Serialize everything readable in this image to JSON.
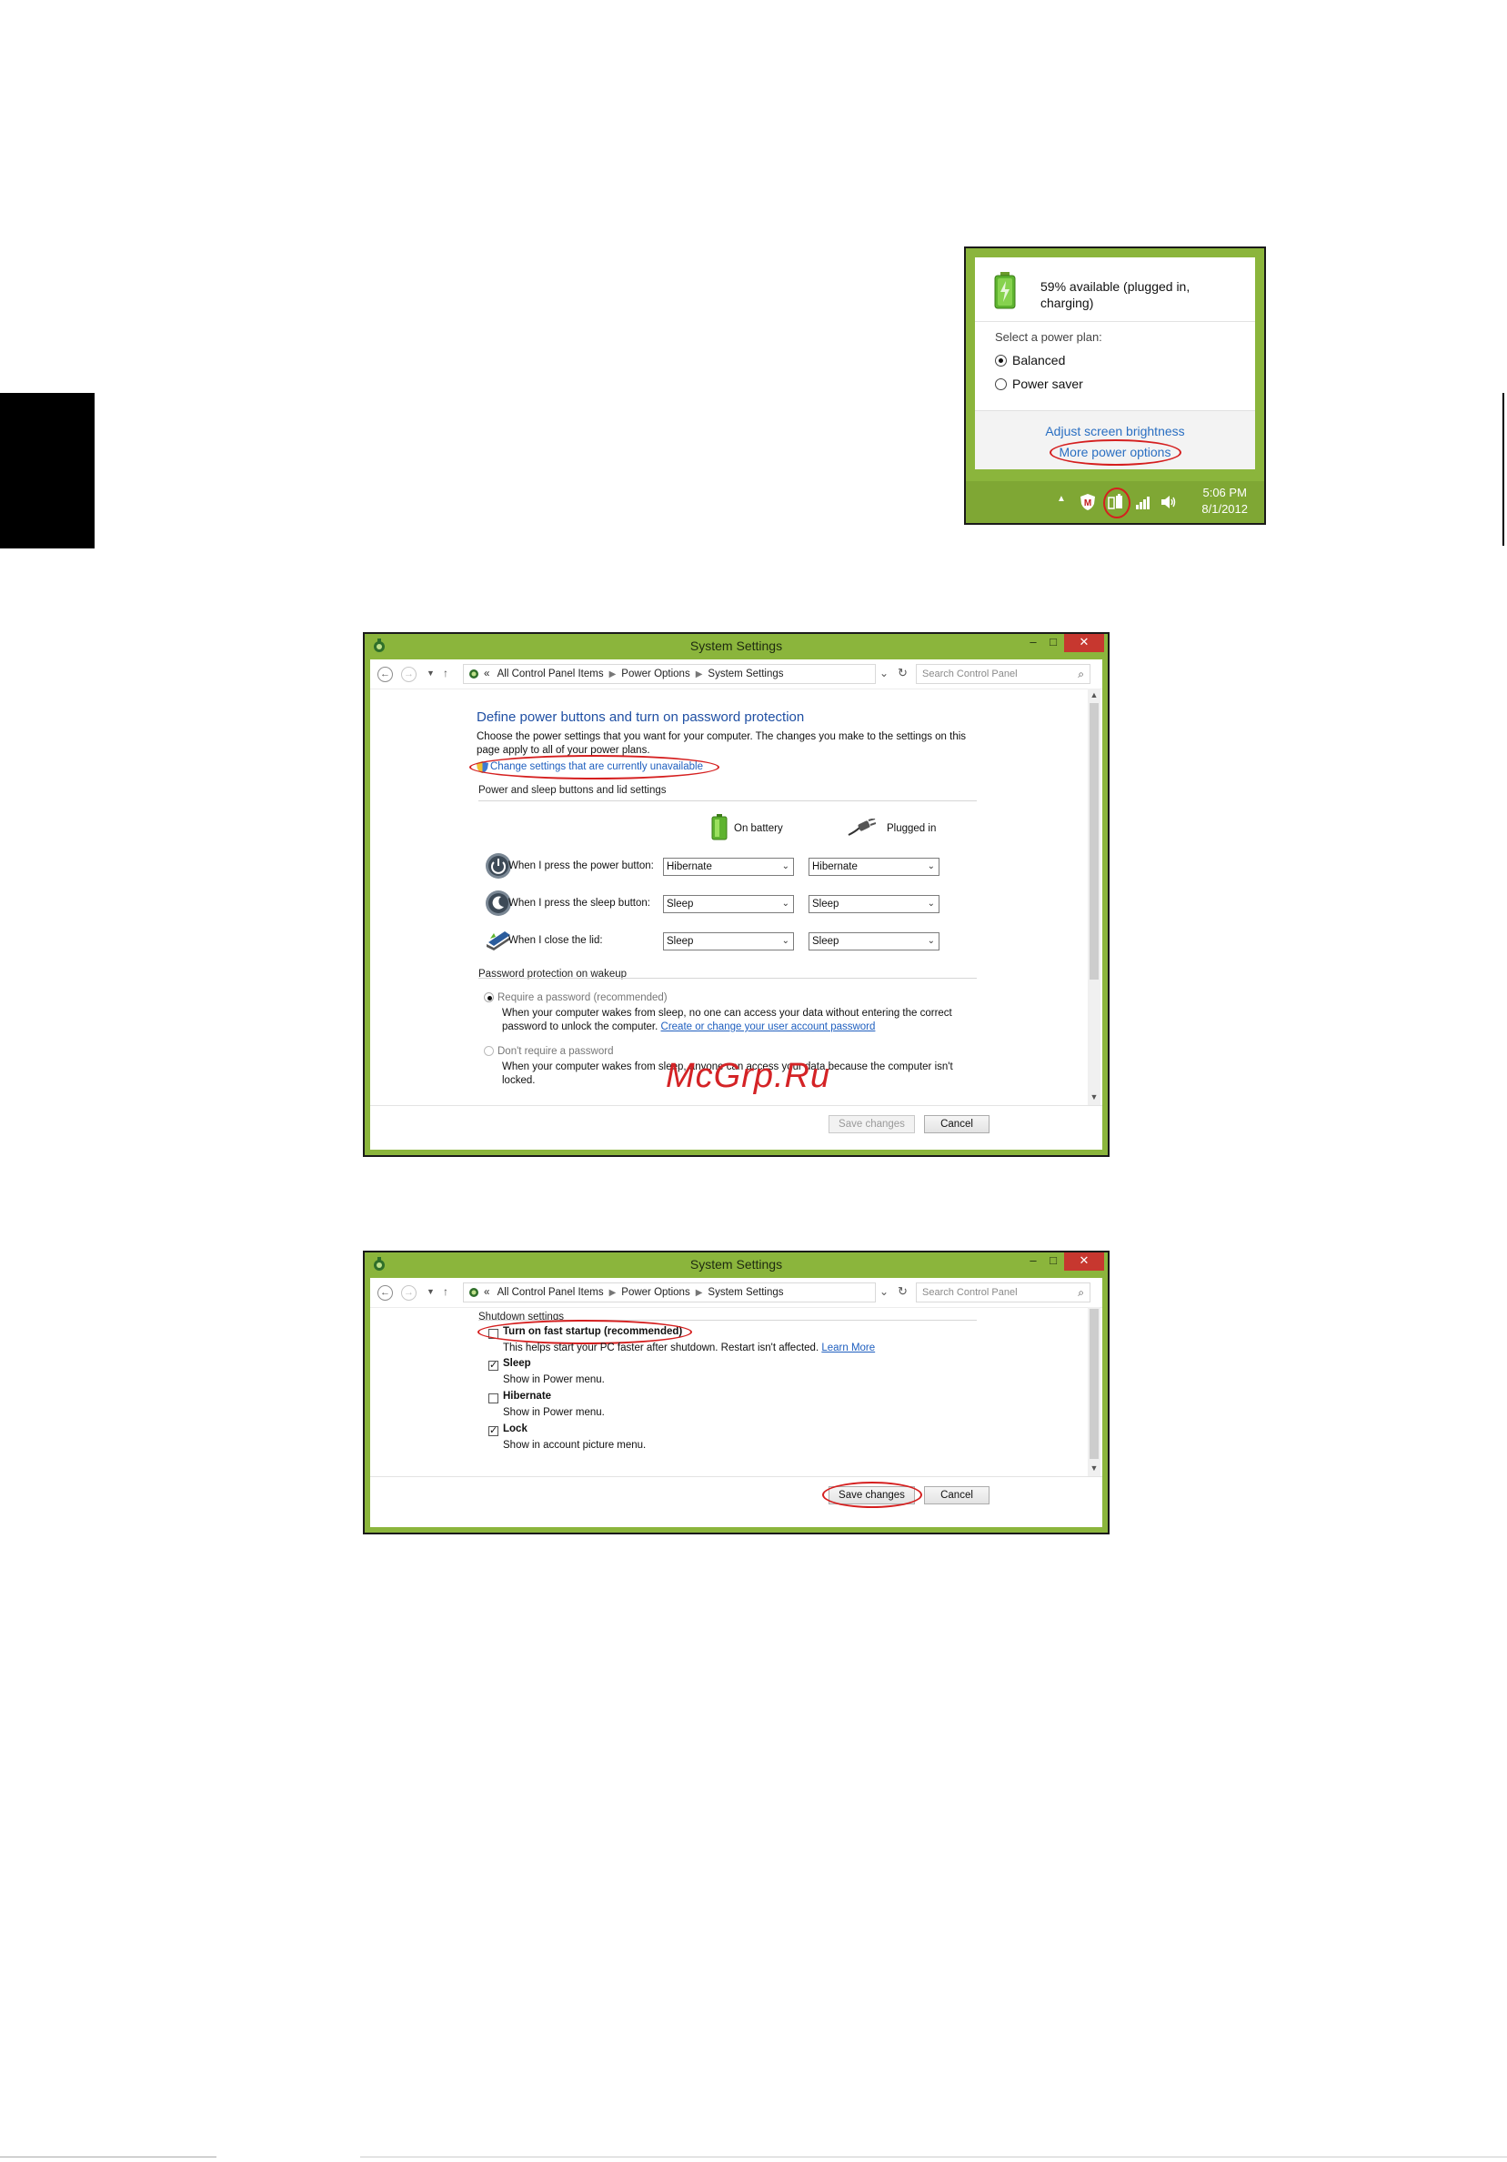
{
  "watermark": "McGrp.Ru",
  "flyout": {
    "battery_status": "59% available (plugged in, charging)",
    "plan_label": "Select a power plan:",
    "plans": [
      {
        "label": "Balanced",
        "selected": true
      },
      {
        "label": "Power saver",
        "selected": false
      }
    ],
    "adjust_brightness": "Adjust screen brightness",
    "more_power_options": "More power options",
    "clock_time": "5:06 PM",
    "clock_date": "8/1/2012",
    "taskbar_color": "#7fa734",
    "highlight_color": "#d51f1f"
  },
  "window1": {
    "title": "System Settings",
    "breadcrumb": {
      "prefix": "«",
      "items": [
        "All Control Panel Items",
        "Power Options",
        "System Settings"
      ]
    },
    "search_placeholder": "Search Control Panel",
    "heading": "Define power buttons and turn on password protection",
    "description": "Choose the power settings that you want for your computer. The changes you make to the settings on this page apply to all of your power plans.",
    "change_settings_link": "Change settings that are currently unavailable",
    "section_buttons": "Power and sleep buttons and lid settings",
    "col_battery": "On battery",
    "col_plugged": "Plugged in",
    "rows": [
      {
        "label": "When I press the power button:",
        "battery": "Hibernate",
        "plugged": "Hibernate"
      },
      {
        "label": "When I press the sleep button:",
        "battery": "Sleep",
        "plugged": "Sleep"
      },
      {
        "label": "When I close the lid:",
        "battery": "Sleep",
        "plugged": "Sleep"
      }
    ],
    "section_password": "Password protection on wakeup",
    "opt_require": "Require a password (recommended)",
    "opt_require_desc": "When your computer wakes from sleep, no one can access your data without entering the correct password to unlock the computer.",
    "opt_require_link": "Create or change your user account password",
    "opt_dont": "Don't require a password",
    "opt_dont_desc": "When your computer wakes from sleep, anyone can access your data because the computer isn't locked.",
    "save_button": "Save changes",
    "cancel_button": "Cancel"
  },
  "window2": {
    "title": "System Settings",
    "breadcrumb": {
      "prefix": "«",
      "items": [
        "All Control Panel Items",
        "Power Options",
        "System Settings"
      ]
    },
    "search_placeholder": "Search Control Panel",
    "section_shutdown": "Shutdown settings",
    "items": [
      {
        "label": "Turn on fast startup (recommended)",
        "checked": false,
        "desc": "This helps start your PC faster after shutdown. Restart isn't affected.",
        "link": "Learn More"
      },
      {
        "label": "Sleep",
        "checked": true,
        "desc": "Show in Power menu."
      },
      {
        "label": "Hibernate",
        "checked": false,
        "desc": "Show in Power menu."
      },
      {
        "label": "Lock",
        "checked": true,
        "desc": "Show in account picture menu."
      }
    ],
    "save_button": "Save changes",
    "cancel_button": "Cancel"
  }
}
